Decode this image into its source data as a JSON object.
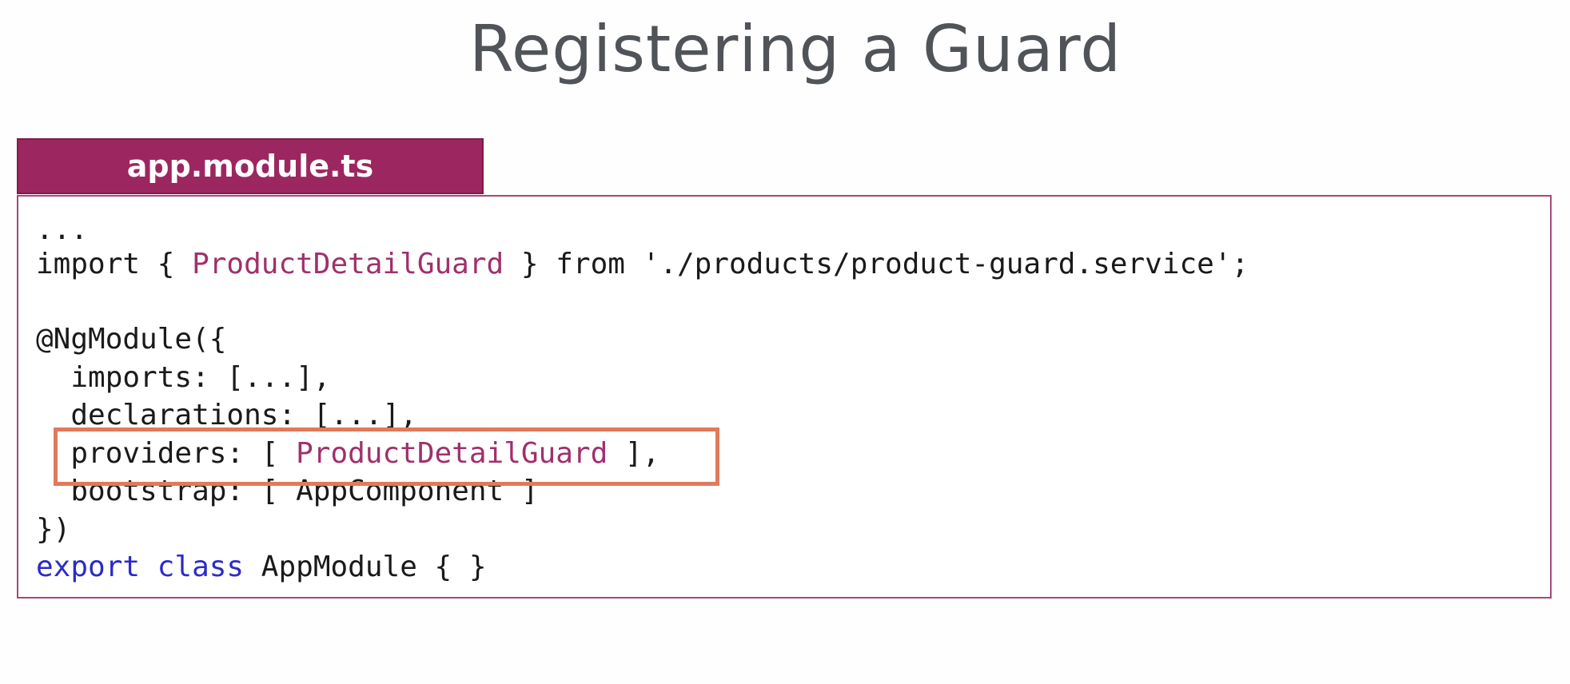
{
  "slide": {
    "title": "Registering a Guard"
  },
  "file_tab": {
    "label": "app.module.ts"
  },
  "code": {
    "line1": "...",
    "line2": {
      "prefix": "import { ",
      "class_name": "ProductDetailGuard",
      "suffix": " } from './products/product-guard.service';"
    },
    "line4": "@NgModule({",
    "line5": "  imports: [...],",
    "line6": "  declarations: [...],",
    "line7": {
      "prefix": "  providers: [ ",
      "class_name": "ProductDetailGuard",
      "suffix": " ],"
    },
    "line8": "  bootstrap: [ AppComponent ]",
    "line9": "})",
    "line10": {
      "keyword1": "export",
      "keyword2": "class",
      "rest": "AppModule { }"
    }
  },
  "colors": {
    "tab_background": "#9c2760",
    "class_name": "#a0306b",
    "keyword": "#2b2bc8",
    "highlight_box": "#e07a5a",
    "title_text": "#505458"
  }
}
